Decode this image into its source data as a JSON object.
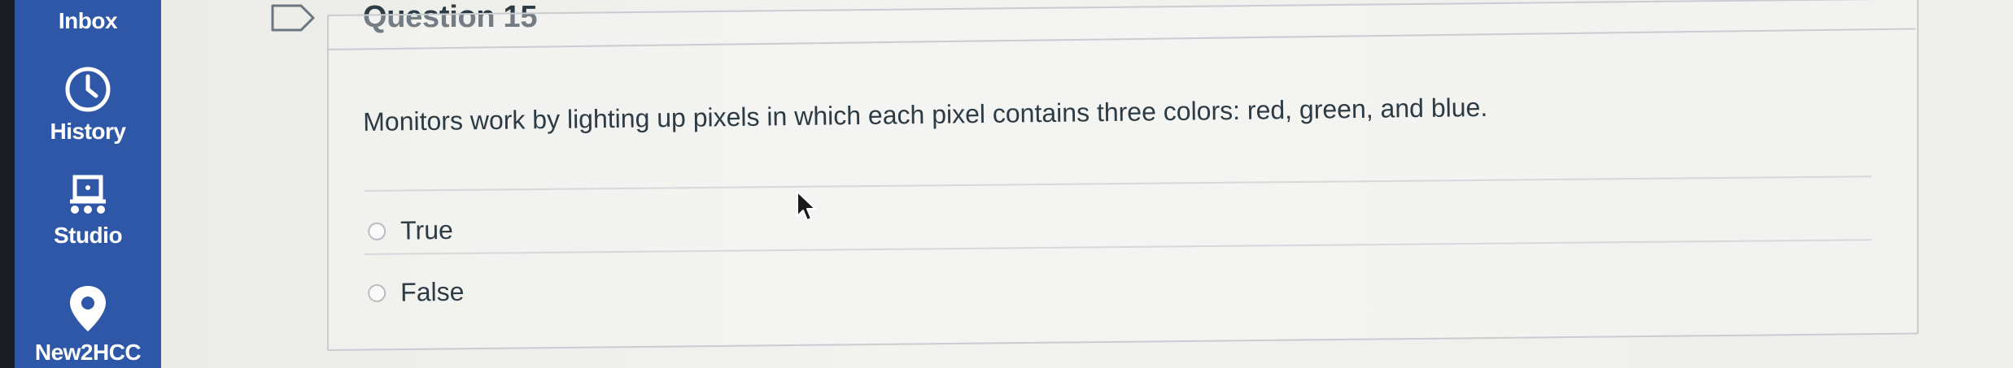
{
  "sidebar": {
    "items": [
      {
        "label": "Inbox",
        "icon": "inbox-icon"
      },
      {
        "label": "History",
        "icon": "clock-icon"
      },
      {
        "label": "Studio",
        "icon": "studio-icon"
      },
      {
        "label": "New2HCC",
        "icon": "map-pin-icon"
      }
    ]
  },
  "question": {
    "title": "Question 15",
    "text": "Monitors work by lighting up pixels in which each pixel contains three colors: red, green, and blue.",
    "answers": [
      {
        "label": "True",
        "selected": false
      },
      {
        "label": "False",
        "selected": false
      }
    ]
  },
  "colors": {
    "sidebar_bg": "#2f57a8",
    "text": "#2d3b45",
    "border": "#c7cdd1"
  }
}
